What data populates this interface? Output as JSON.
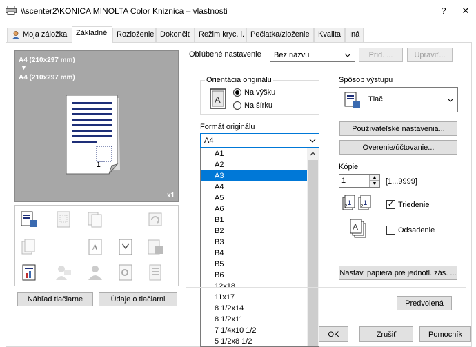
{
  "window": {
    "title": "\\\\scenter2\\KONICA MINOLTA Color Kniznica – vlastnosti",
    "close_glyph": "✕"
  },
  "tabs": [
    {
      "label": "Moja záložka",
      "active": false
    },
    {
      "label": "Základné",
      "active": true
    },
    {
      "label": "Rozloženie",
      "active": false
    },
    {
      "label": "Dokončiť",
      "active": false
    },
    {
      "label": "Režim kryc. l.",
      "active": false
    },
    {
      "label": "Pečiatka/zloženie",
      "active": false
    },
    {
      "label": "Kvalita",
      "active": false
    },
    {
      "label": "Iná",
      "active": false
    }
  ],
  "preview": {
    "line1": "A4 (210x297 mm)",
    "arrow": "▼",
    "line2": "A4 (210x297 mm)",
    "page_number": "1",
    "copies": "x1"
  },
  "left_buttons": {
    "print_preview": "Náhľad tlačiarne",
    "printer_info": "Údaje o tlačiarni"
  },
  "favorites": {
    "label": "Obľúbené nastavenie",
    "value": "Bez názvu",
    "add_button": "Prid. ...",
    "edit_button": "Upraviť..."
  },
  "orientation": {
    "legend": "Orientácia originálu",
    "portrait_label": "Na výšku",
    "landscape_label": "Na šírku",
    "selected": "portrait"
  },
  "paper_format": {
    "label": "Formát originálu",
    "value": "A4",
    "options": [
      "A1",
      "A2",
      "A3",
      "A4",
      "A5",
      "A6",
      "B1",
      "B2",
      "B3",
      "B4",
      "B5",
      "B6",
      "12x18",
      "11x17",
      "8 1/2x14",
      "8 1/2x11",
      "7 1/4x10 1/2",
      "5 1/2x8 1/2"
    ],
    "highlighted": "A3"
  },
  "output_method": {
    "label": "Spôsob výstupu",
    "value": "Tlač"
  },
  "right_buttons": {
    "user_settings": "Používateľské nastavenia...",
    "verification": "Overenie/účtovanie..."
  },
  "copies": {
    "label": "Kópie",
    "value": "1",
    "range": "[1...9999]"
  },
  "collate": {
    "label": "Triedenie",
    "checked": true
  },
  "offset": {
    "label": "Odsadenie",
    "checked": false
  },
  "paper_settings_button": "Nastav. papiera pre jednotl. zás. ...",
  "default_button": "Predvolená",
  "footer": {
    "ok": "OK",
    "cancel": "Zrušiť",
    "help": "Pomocník"
  },
  "colors": {
    "selection": "#0078d7",
    "preview_bg": "#a7a7a7"
  }
}
